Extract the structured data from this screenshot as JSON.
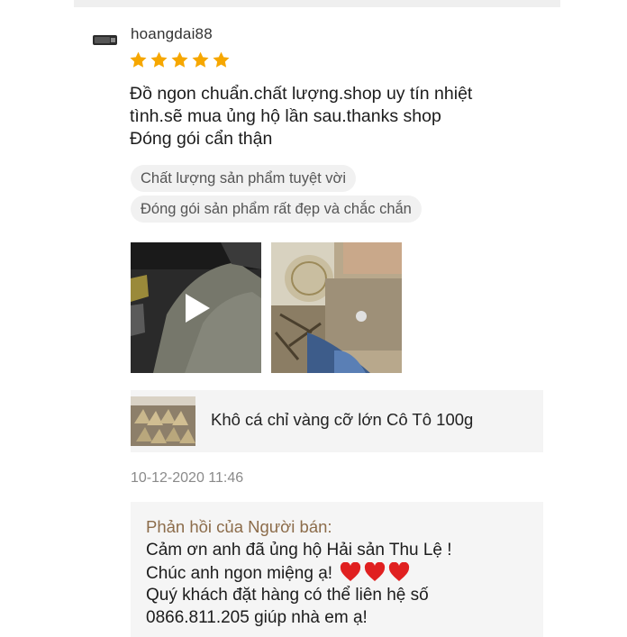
{
  "review": {
    "username": "hoangdai88",
    "rating": 5,
    "comment_lines": [
      "Đồ ngon chuẩn.chất lượng.shop uy tín nhiệt",
      "tình.sẽ mua ủng hộ lần sau.thanks shop",
      "Đóng gói cẩn thận"
    ],
    "tags": [
      "Chất lượng sản phẩm tuyệt vời",
      "Đóng gói sản phẩm rất đẹp và chắc chắn"
    ],
    "product_name": "Khô cá chỉ vàng cỡ lớn Cô Tô 100g",
    "datetime": "10-12-2020 11:46"
  },
  "seller_reply": {
    "title": "Phản hồi của Người bán:",
    "lines": [
      "Cảm ơn anh đã ủng hộ Hải sản Thu Lệ !",
      "Chúc anh ngon miệng ạ!",
      "Quý khách đặt hàng có thể liên hệ số",
      "0866.811.205 giúp nhà em ạ!"
    ],
    "heart_count": 3
  },
  "colors": {
    "star": "#f6a700",
    "reply_title": "#8c6c4a",
    "heart": "#e02020",
    "tag_bg": "#f1f1f1"
  },
  "icons": {
    "rating": "star-icon",
    "video": "play-icon",
    "emoji": "red-heart-icon"
  }
}
